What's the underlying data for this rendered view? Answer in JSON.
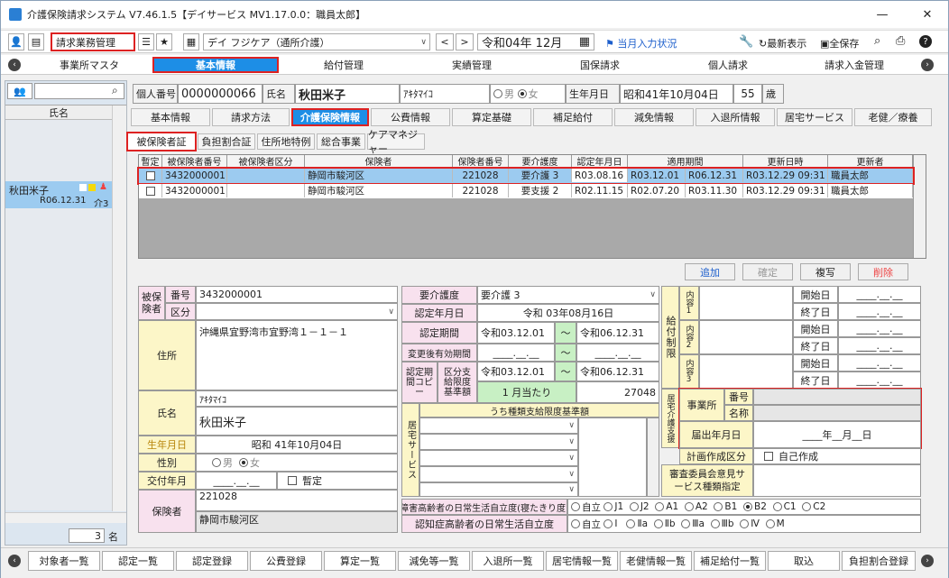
{
  "window": {
    "title": "介護保険請求システム V7.46.1.5【デイサービス MV1.17.0.0：職員太郎】",
    "min": "—",
    "max": "☐",
    "close": "✕"
  },
  "toolbar": {
    "mode": "請求業務管理",
    "office": "デイ フジケア（通所介護）",
    "period": "令和04年 12月",
    "input_status": "当月入力状況",
    "latest": "最新表示",
    "save_all": "全保存"
  },
  "nav": {
    "items": [
      "事業所マスタ",
      "基本情報",
      "給付管理",
      "実績管理",
      "国保請求",
      "個人請求",
      "請求入金管理"
    ]
  },
  "left": {
    "search_placeholder": "",
    "col_header": "氏名",
    "patient_name": "秋田米子",
    "patient_date": "R06.12.31",
    "patient_level": "介3",
    "count": "3",
    "count_unit": "名"
  },
  "header": {
    "id_label": "個人番号",
    "id_value": "0000000066",
    "name_label": "氏名",
    "name": "秋田米子",
    "kana": "ｱｷﾀﾏｲｺ",
    "male": "男",
    "female": "女",
    "birth_label": "生年月日",
    "birth": "昭和41年10月04日",
    "age": "55",
    "age_unit": "歳"
  },
  "tabs": [
    "基本情報",
    "請求方法",
    "介護保険情報",
    "公費情報",
    "算定基礎",
    "補足給付",
    "減免情報",
    "入退所情報",
    "居宅サービス",
    "老健／療養"
  ],
  "subtabs": [
    "被保険者証",
    "負担割合証",
    "住所地特例",
    "総合事業",
    "ケアマネジャー"
  ],
  "grid": {
    "headers": [
      "暫定",
      "被保険者番号",
      "被保険者区分",
      "保険者",
      "保険者番号",
      "要介護度",
      "認定年月日",
      "適用期間",
      "",
      "更新日時",
      "更新者"
    ],
    "rows": [
      [
        "",
        "3432000001",
        "",
        "静岡市駿河区",
        "221028",
        "要介護 3",
        "R03.08.16",
        "R03.12.01",
        "R06.12.31",
        "R03.12.29 09:31",
        "職員太郎"
      ],
      [
        "",
        "3432000001",
        "",
        "静岡市駿河区",
        "221028",
        "要支援 2",
        "R02.11.15",
        "R02.07.20",
        "R03.11.30",
        "R03.12.29 09:31",
        "職員太郎"
      ]
    ]
  },
  "actions": {
    "add": "追加",
    "confirm": "確定",
    "copy": "複写",
    "delete": "削除"
  },
  "form": {
    "insured_label": "被保険者",
    "num_label": "番号",
    "num_value": "3432000001",
    "kbn_label": "区分",
    "addr_label": "住所",
    "addr_value": "沖縄県宜野湾市宜野湾１－１－１",
    "name_label": "氏名",
    "kana_value": "ｱｷﾀﾏｲｺ",
    "name_value": "秋田米子",
    "birth_label": "生年月日",
    "birth_value": "昭和 41年10月04日",
    "sex_label": "性別",
    "male": "男",
    "female": "女",
    "issue_label": "交付年月",
    "issue_value": "____.__.__",
    "tentative": "暫定",
    "insurer_label": "保険者",
    "insurer_no": "221028",
    "insurer_name": "静岡市駿河区",
    "care_level_label": "要介護度",
    "care_level": "要介護 3",
    "cert_date_label": "認定年月日",
    "cert_date": "令和 03年08月16日",
    "cert_period_label": "認定期間",
    "cert_from": "令和03.12.01",
    "cert_to": "令和06.12.31",
    "tilde": "～",
    "chg_label": "変更後有効期間",
    "chg_from": "____.__.__",
    "chg_to": "____.__.__",
    "copy_label": "認定期間コピー",
    "limit_label": "区分支給限度基準額",
    "lim_from": "令和03.12.01",
    "lim_to": "令和06.12.31",
    "per_month": "1 月当たり",
    "limit_value": "27048",
    "kyotaku_label": "居宅サービス",
    "kind_header": "うち種類支給限度基準額",
    "dementia1_label": "障害高齢者の日常生活自立度(寝たきり度)",
    "dementia1_opts": [
      "自立",
      "J1",
      "J2",
      "A1",
      "A2",
      "B1",
      "B2",
      "C1",
      "C2"
    ],
    "dementia2_label": "認知症高齢者の日常生活自立度",
    "dementia2_opts": [
      "自立",
      "Ⅰ",
      "Ⅱa",
      "Ⅱb",
      "Ⅲa",
      "Ⅲb",
      "Ⅳ",
      "M"
    ],
    "limit_contents_label": "給付制限",
    "content_labels": [
      "内容1",
      "内容2",
      "内容3"
    ],
    "start": "開始日",
    "end": "終了日",
    "blank_date": "____.__.__",
    "support_label": "居宅介護支援",
    "office_label": "事業所",
    "office_no_label": "番号",
    "office_name_label": "名称",
    "notify_label": "届出年月日",
    "notify_value": "____年__月__日",
    "plan_label": "計画作成区分",
    "self_made": "自己作成",
    "opinion_label": "審査委員会意見サービス種類指定"
  },
  "bottom": [
    "対象者一覧",
    "認定一覧",
    "認定登録",
    "公費登録",
    "算定一覧",
    "減免等一覧",
    "入退所一覧",
    "居宅情報一覧",
    "老健情報一覧",
    "補足給付一覧",
    "取込",
    "負担割合登録"
  ]
}
